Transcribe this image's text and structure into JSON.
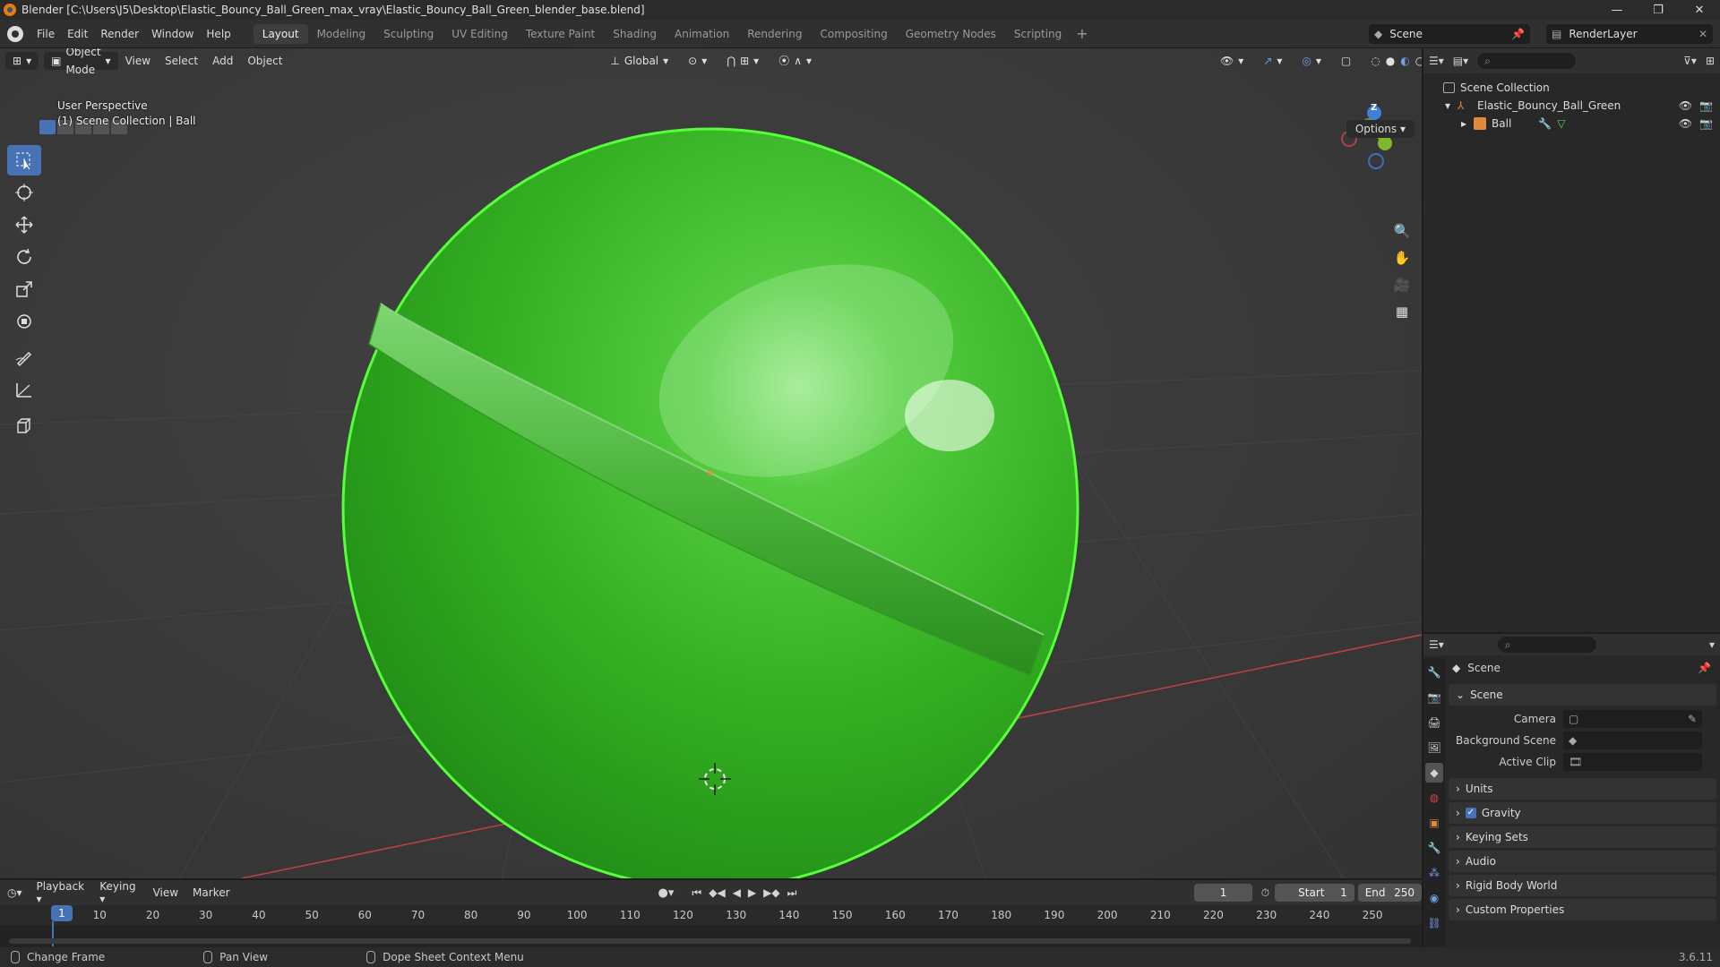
{
  "window": {
    "title": "Blender [C:\\Users\\J5\\Desktop\\Elastic_Bouncy_Ball_Green_max_vray\\Elastic_Bouncy_Ball_Green_blender_base.blend]",
    "minimize": "—",
    "maximize": "❐",
    "close": "✕"
  },
  "menus": [
    "File",
    "Edit",
    "Render",
    "Window",
    "Help"
  ],
  "workspaces": [
    "Layout",
    "Modeling",
    "Sculpting",
    "UV Editing",
    "Texture Paint",
    "Shading",
    "Animation",
    "Rendering",
    "Compositing",
    "Geometry Nodes",
    "Scripting"
  ],
  "workspace_plus": "+",
  "scene_name": "Scene",
  "view_layer": "RenderLayer",
  "viewport": {
    "mode": "Object Mode",
    "menus": [
      "View",
      "Select",
      "Add",
      "Object"
    ],
    "orientation": "Global",
    "options": "Options",
    "info_line1": "User Perspective",
    "info_line2": "(1) Scene Collection | Ball",
    "gizmo": {
      "x": "X",
      "y": "Y",
      "z": "Z"
    }
  },
  "outliner": {
    "root": "Scene Collection",
    "collection": "Elastic_Bouncy_Ball_Green",
    "object": "Ball"
  },
  "properties": {
    "context": "Scene",
    "section_scene": "Scene",
    "camera_label": "Camera",
    "bg_scene_label": "Background Scene",
    "active_clip_label": "Active Clip",
    "collapsed": [
      "Units",
      "Gravity",
      "Keying Sets",
      "Audio",
      "Rigid Body World",
      "Custom Properties"
    ]
  },
  "timeline": {
    "menus": [
      "Playback",
      "Keying",
      "View",
      "Marker"
    ],
    "current_frame": "1",
    "start_label": "Start",
    "start": "1",
    "end_label": "End",
    "end": "250",
    "ticks": [
      "10",
      "20",
      "30",
      "40",
      "50",
      "60",
      "70",
      "80",
      "90",
      "100",
      "110",
      "120",
      "130",
      "140",
      "150",
      "160",
      "170",
      "180",
      "190",
      "200",
      "210",
      "220",
      "230",
      "240",
      "250"
    ],
    "playhead": "1"
  },
  "status": {
    "left": "Change Frame",
    "middle": "Pan View",
    "right": "Dope Sheet Context Menu",
    "version": "3.6.11"
  },
  "colors": {
    "accent": "#4772b3",
    "ball": "#3cbb2a",
    "x_axis": "#d9424c",
    "y_axis": "#7fb82b",
    "z_axis": "#3f7fd8"
  }
}
